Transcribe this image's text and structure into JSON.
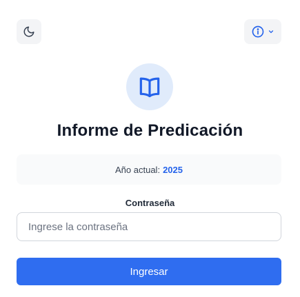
{
  "header": {
    "theme_toggle_icon": "moon-icon",
    "info_menu_icon": "info-icon",
    "info_menu_chevron": "chevron-down-icon"
  },
  "logo": {
    "icon": "open-book-icon"
  },
  "title": "Informe de Predicación",
  "year": {
    "label": "Año actual:",
    "value": "2025"
  },
  "password": {
    "label": "Contraseña",
    "placeholder": "Ingrese la contraseña",
    "value": ""
  },
  "submit_label": "Ingresar",
  "colors": {
    "accent": "#2f6df0",
    "accent_text": "#2563eb",
    "logo_bg": "#e0ebfb",
    "surface": "#f3f4f6"
  }
}
